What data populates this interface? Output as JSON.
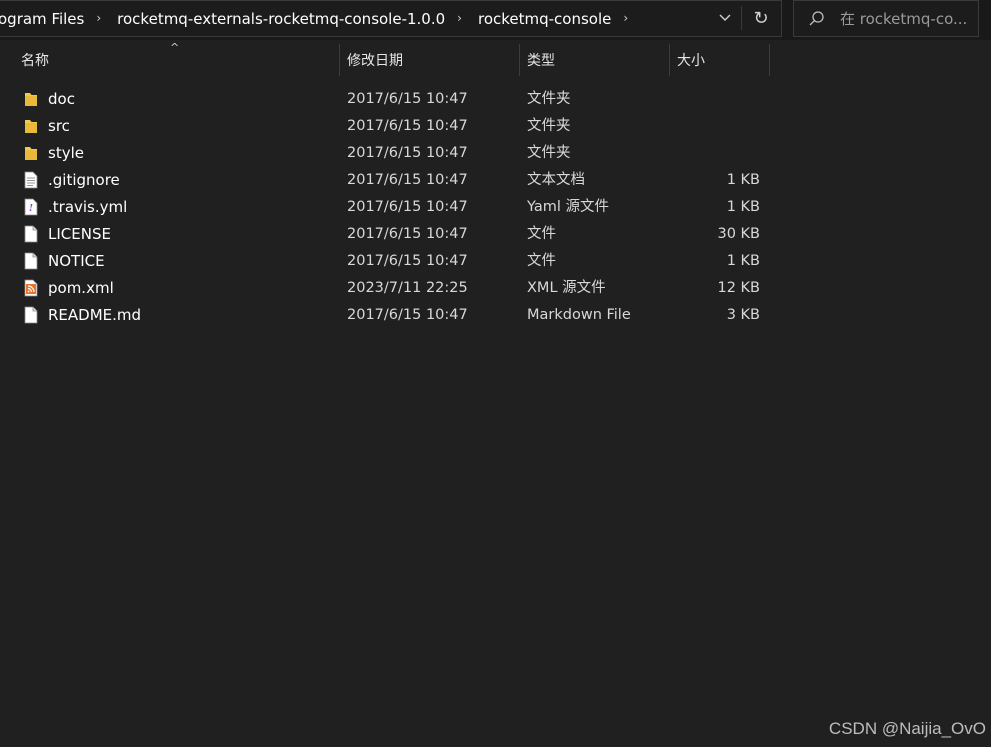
{
  "breadcrumb": {
    "items": [
      "ogram Files",
      "rocketmq-externals-rocketmq-console-1.0.0",
      "rocketmq-console"
    ]
  },
  "search": {
    "placeholder": "在 rocketmq-co..."
  },
  "columns": {
    "name": "名称",
    "date": "修改日期",
    "type": "类型",
    "size": "大小"
  },
  "files": [
    {
      "name": "doc",
      "date": "2017/6/15 10:47",
      "type": "文件夹",
      "size": "",
      "icon": "folder-icon"
    },
    {
      "name": "src",
      "date": "2017/6/15 10:47",
      "type": "文件夹",
      "size": "",
      "icon": "folder-icon"
    },
    {
      "name": "style",
      "date": "2017/6/15 10:47",
      "type": "文件夹",
      "size": "",
      "icon": "folder-icon"
    },
    {
      "name": ".gitignore",
      "date": "2017/6/15 10:47",
      "type": "文本文档",
      "size": "1 KB",
      "icon": "text-file-icon"
    },
    {
      "name": ".travis.yml",
      "date": "2017/6/15 10:47",
      "type": "Yaml 源文件",
      "size": "1 KB",
      "icon": "yaml-file-icon"
    },
    {
      "name": "LICENSE",
      "date": "2017/6/15 10:47",
      "type": "文件",
      "size": "30 KB",
      "icon": "file-icon"
    },
    {
      "name": "NOTICE",
      "date": "2017/6/15 10:47",
      "type": "文件",
      "size": "1 KB",
      "icon": "file-icon"
    },
    {
      "name": "pom.xml",
      "date": "2023/7/11 22:25",
      "type": "XML 源文件",
      "size": "12 KB",
      "icon": "xml-file-icon"
    },
    {
      "name": "README.md",
      "date": "2017/6/15 10:47",
      "type": "Markdown File",
      "size": "3 KB",
      "icon": "file-icon"
    }
  ],
  "watermark": "CSDN @Naijia_OvO",
  "colors": {
    "background": "#202020",
    "folder": "#f2c94c",
    "xml": "#e8742b"
  }
}
